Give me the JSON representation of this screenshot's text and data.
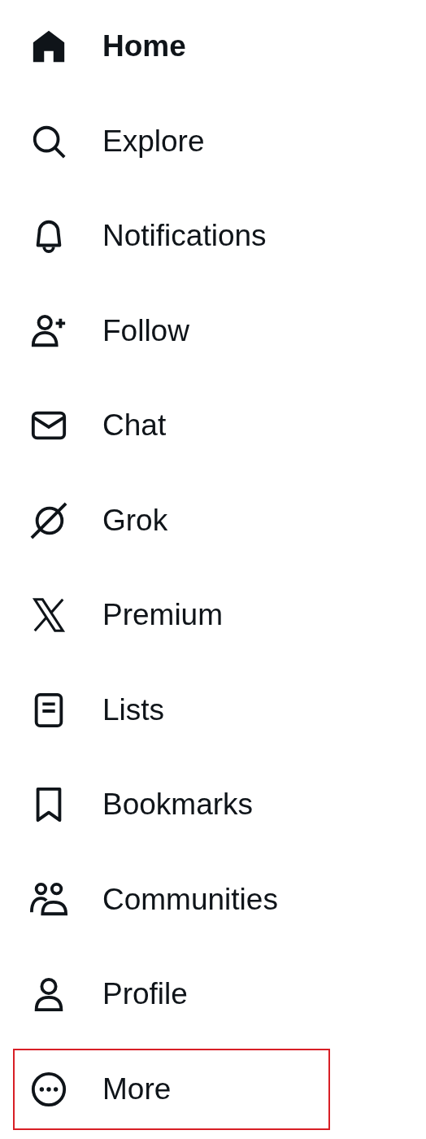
{
  "nav": {
    "items": [
      {
        "label": "Home",
        "selected": true,
        "highlighted": false
      },
      {
        "label": "Explore",
        "selected": false,
        "highlighted": false
      },
      {
        "label": "Notifications",
        "selected": false,
        "highlighted": false
      },
      {
        "label": "Follow",
        "selected": false,
        "highlighted": false
      },
      {
        "label": "Chat",
        "selected": false,
        "highlighted": false
      },
      {
        "label": "Grok",
        "selected": false,
        "highlighted": false
      },
      {
        "label": "Premium",
        "selected": false,
        "highlighted": false
      },
      {
        "label": "Lists",
        "selected": false,
        "highlighted": false
      },
      {
        "label": "Bookmarks",
        "selected": false,
        "highlighted": false
      },
      {
        "label": "Communities",
        "selected": false,
        "highlighted": false
      },
      {
        "label": "Profile",
        "selected": false,
        "highlighted": false
      },
      {
        "label": "More",
        "selected": false,
        "highlighted": true
      }
    ]
  }
}
